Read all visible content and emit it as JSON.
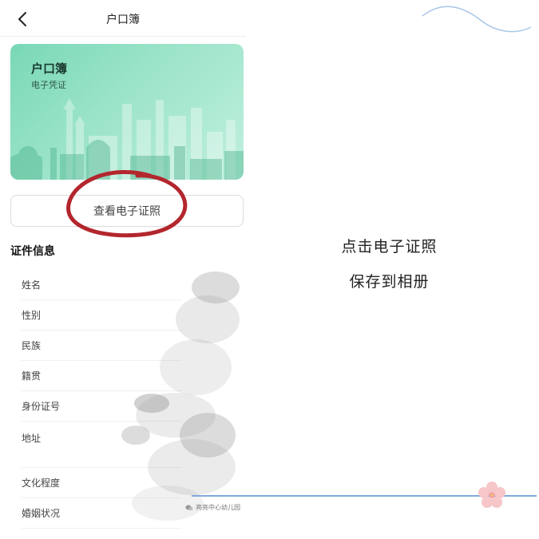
{
  "navbar": {
    "title": "户口簿"
  },
  "card": {
    "title": "户口簿",
    "subtitle": "电子凭证"
  },
  "view_button": {
    "label": "查看电子证照"
  },
  "section": {
    "title": "证件信息"
  },
  "info_fields": [
    {
      "label": "姓名"
    },
    {
      "label": "性别"
    },
    {
      "label": "民族"
    },
    {
      "label": "籍贯"
    },
    {
      "label": "身份证号"
    },
    {
      "label": "地址"
    },
    {
      "label": "文化程度"
    },
    {
      "label": "婚姻状况"
    }
  ],
  "instructions": {
    "line1": "点击电子证照",
    "line2": "保存到相册"
  },
  "watermark": {
    "text": "亮亮中心幼儿园"
  },
  "colors": {
    "card_green": "#79d8b6",
    "circle_red": "#b3262d",
    "line_blue": "#7fa9e0"
  }
}
